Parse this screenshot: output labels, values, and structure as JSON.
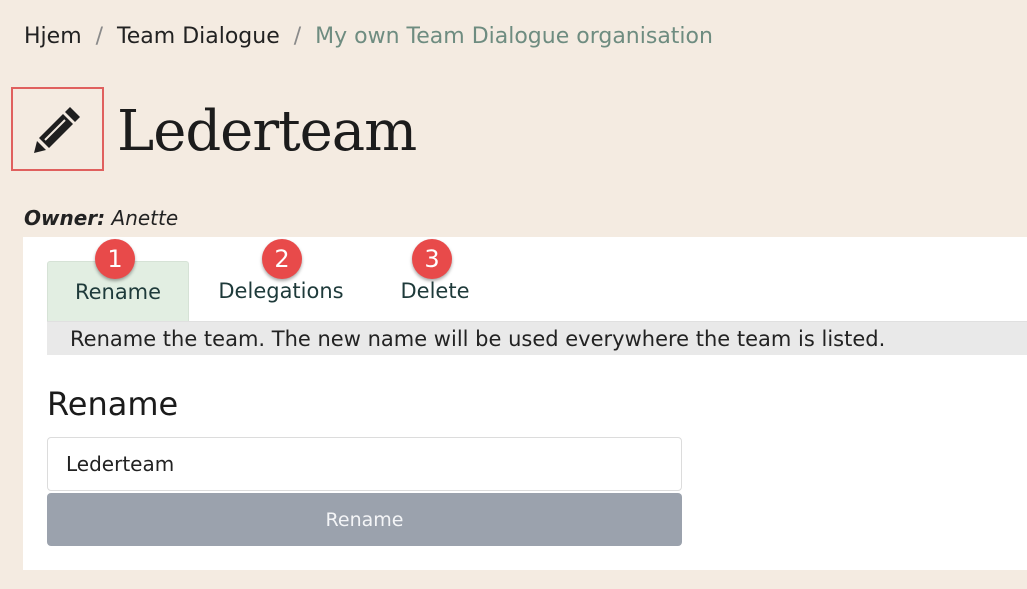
{
  "breadcrumb": {
    "home": "Hjem",
    "section": "Team Dialogue",
    "current": "My own Team Dialogue organisation",
    "separator": "/"
  },
  "header": {
    "edit_icon": "pencil-icon",
    "title": "Lederteam"
  },
  "owner": {
    "label": "Owner:",
    "value": "Anette"
  },
  "tabs": [
    {
      "label": "Rename",
      "badge": "1",
      "active": true
    },
    {
      "label": "Delegations",
      "badge": "2",
      "active": false
    },
    {
      "label": "Delete",
      "badge": "3",
      "active": false
    }
  ],
  "tab_description": "Rename the team. The new name will be used everywhere the team is listed.",
  "rename_form": {
    "heading": "Rename",
    "input_value": "Lederteam",
    "button_label": "Rename"
  },
  "colors": {
    "page_background": "#f4ebe1",
    "highlight_border": "#e0605e",
    "badge": "#e84a4a",
    "active_tab": "#e2eee2",
    "button": "#9ba2ad",
    "breadcrumb_current": "#6e8c80"
  }
}
